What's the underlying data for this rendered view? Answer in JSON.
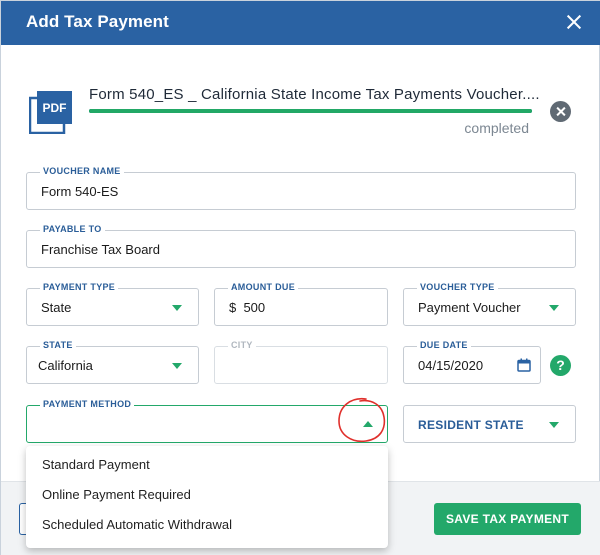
{
  "header": {
    "title": "Add Tax Payment"
  },
  "file": {
    "icon": "pdf-file-icon",
    "icon_label": "PDF",
    "name": "Form 540_ES _ California State Income Tax Payments Voucher....",
    "status": "completed",
    "progress_percent": 100
  },
  "fields": {
    "voucher_name": {
      "label": "VOUCHER NAME",
      "value": "Form 540-ES"
    },
    "payable_to": {
      "label": "PAYABLE TO",
      "value": "Franchise Tax Board"
    },
    "payment_type": {
      "label": "PAYMENT TYPE",
      "value": "State"
    },
    "amount_due": {
      "label": "AMOUNT DUE",
      "value": "$  500"
    },
    "voucher_type": {
      "label": "VOUCHER TYPE",
      "value": "Payment Voucher"
    },
    "state": {
      "label": "STATE",
      "value": "California"
    },
    "city": {
      "label": "CITY",
      "value": ""
    },
    "due_date": {
      "label": "DUE DATE",
      "value": "04/15/2020"
    },
    "payment_method": {
      "label": "PAYMENT METHOD",
      "value": ""
    }
  },
  "help": {
    "glyph": "?"
  },
  "resident_state": {
    "label": "RESIDENT STATE"
  },
  "payment_method_options": [
    "Standard Payment",
    "Online Payment Required",
    "Scheduled Automatic Withdrawal"
  ],
  "footer": {
    "save_label": "SAVE TAX PAYMENT"
  },
  "colors": {
    "brand_blue": "#2a62a3",
    "accent_green": "#23a86a",
    "annotation_red": "#e0302c"
  }
}
